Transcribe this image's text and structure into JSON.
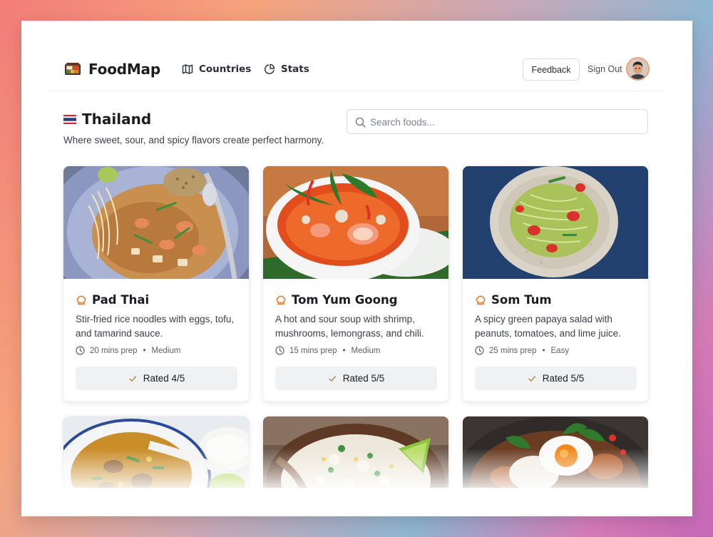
{
  "app": {
    "name": "FoodMap"
  },
  "nav": {
    "countries": "Countries",
    "stats": "Stats"
  },
  "header": {
    "feedback_label": "Feedback",
    "signout_label": "Sign Out"
  },
  "country": {
    "name": "Thailand",
    "description": "Where sweet, sour, and spicy flavors create perfect harmony."
  },
  "search": {
    "placeholder": "Search foods...",
    "value": ""
  },
  "foods": [
    {
      "title": "Pad Thai",
      "description": "Stir-fried rice noodles with eggs, tofu, and tamarind sauce.",
      "prep": "20 mins prep",
      "difficulty": "Medium",
      "rating": "Rated 4/5"
    },
    {
      "title": "Tom Yum Goong",
      "description": "A hot and sour soup with shrimp, mushrooms, lemongrass, and chili.",
      "prep": "15 mins prep",
      "difficulty": "Medium",
      "rating": "Rated 5/5"
    },
    {
      "title": "Som Tum",
      "description": "A spicy green papaya salad with peanuts, tomatoes, and lime juice.",
      "prep": "25 mins prep",
      "difficulty": "Easy",
      "rating": "Rated 5/5"
    }
  ],
  "meta_separator": "•",
  "colors": {
    "accent": "#e07b2f",
    "text": "#1b1d21",
    "muted": "#5c626b",
    "rating_bg": "#f0f1f3",
    "rating_check": "#b0884a"
  },
  "icons": {
    "brand": "bento-box-icon",
    "countries": "map-icon",
    "stats": "pie-chart-icon",
    "search": "search-icon",
    "dish": "chef-hat-icon",
    "time": "clock-icon",
    "rating": "check-icon"
  }
}
